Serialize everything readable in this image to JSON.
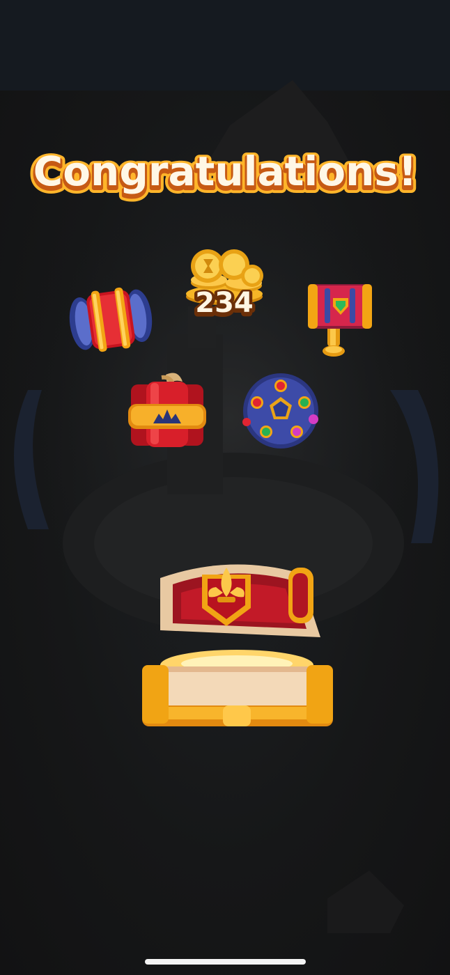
{
  "screen": {
    "title": "Congratulations!"
  },
  "rewards": {
    "coins": {
      "amount": "234",
      "icon": "gold-coins-icon"
    },
    "items": [
      {
        "icon": "rocket-booster-icon"
      },
      {
        "icon": "hammer-booster-icon"
      },
      {
        "icon": "dynamite-booster-icon"
      },
      {
        "icon": "disco-ball-booster-icon"
      }
    ]
  },
  "chest": {
    "icon": "treasure-chest-icon",
    "state": "open"
  },
  "colors": {
    "background": "#131314",
    "title_fill": "#fff7e6",
    "title_outline": "#b8470c",
    "title_gold": "#ffb52a",
    "red": "#cc1f2a",
    "gold": "#f6a316",
    "blue": "#3a4aa0"
  }
}
